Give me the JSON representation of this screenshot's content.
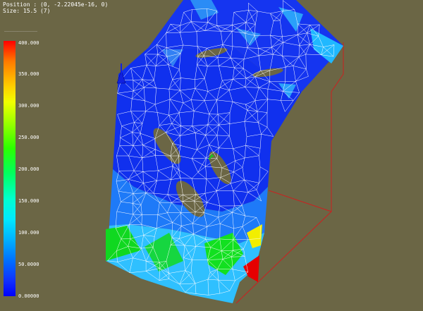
{
  "readout": {
    "position_line": "Position : (0, -2.22045e-16, 0)",
    "value_line": "Size: 15.5 (7)"
  },
  "legend": {
    "title": "_____________",
    "ticks": [
      "400.000",
      "350.000",
      "300.000",
      "250.000",
      "200.000",
      "150.000",
      "100.000",
      "50.0000",
      "0.00000"
    ],
    "colors": {
      "max": "#ff0000",
      "high": "#ffe000",
      "mid": "#00e000",
      "low_mid": "#00e8ff",
      "min": "#0000ff"
    }
  },
  "viewport": {
    "background": "#6b6645",
    "mesh_color": "#ffffff",
    "bounding_box_color": "#cc2020",
    "axis_icons": [
      "axis-triad-icon",
      "pivot-arrow-icon"
    ]
  }
}
